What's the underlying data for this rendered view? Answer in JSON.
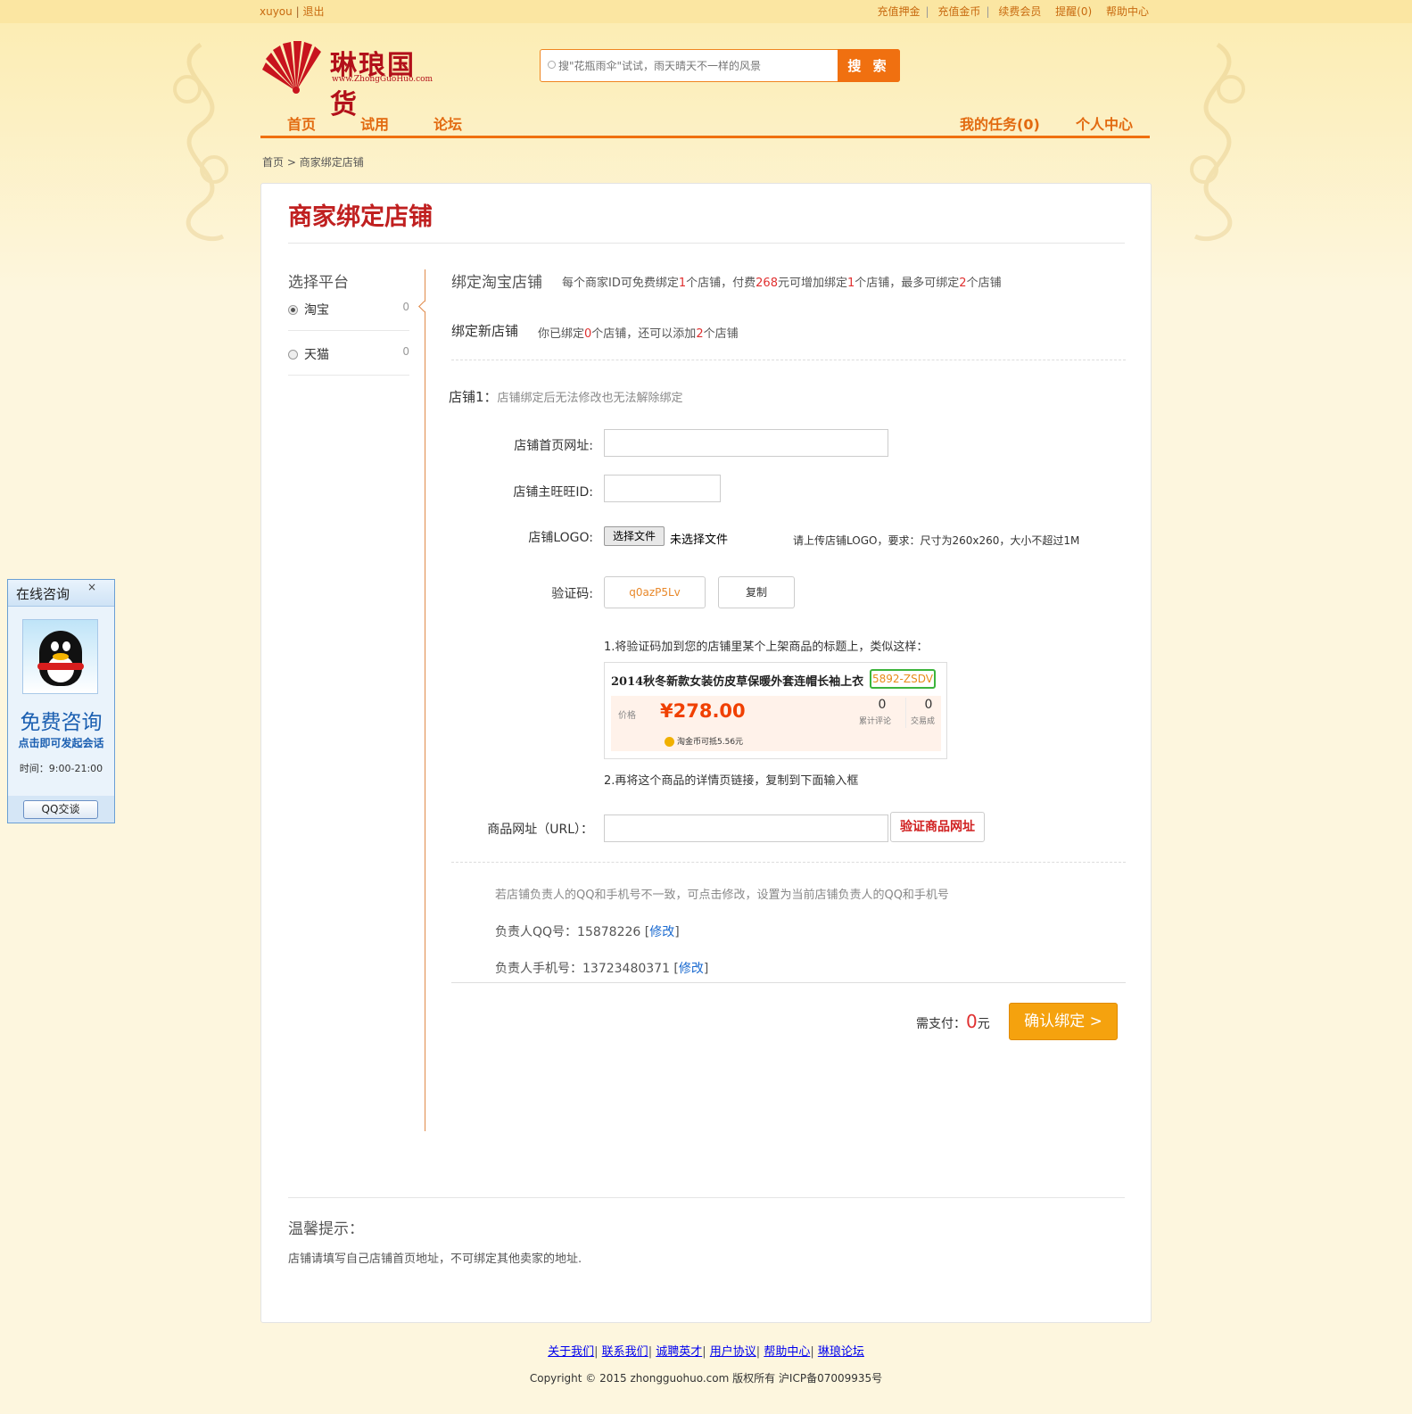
{
  "topbar": {
    "username": "xuyou",
    "logout": "退出",
    "links": [
      "充值押金",
      "充值金币",
      "续费会员",
      "提醒(0)",
      "帮助中心"
    ]
  },
  "logo": {
    "name": "琳琅国货",
    "url": "www.ZhongGuoHuo.com"
  },
  "search": {
    "placeholder": "搜\"花瓶雨伞\"试试，雨天晴天不一样的风景",
    "button": "搜 索"
  },
  "nav": {
    "left": [
      "首页",
      "试用",
      "论坛"
    ],
    "right": [
      "我的任务(0)",
      "个人中心"
    ]
  },
  "breadcrumb": {
    "home": "首页",
    "sep": ">",
    "current": "商家绑定店铺"
  },
  "page_title": "商家绑定店铺",
  "platform": {
    "title": "选择平台",
    "items": [
      {
        "label": "淘宝",
        "count": "0",
        "selected": true
      },
      {
        "label": "天猫",
        "count": "0",
        "selected": false
      }
    ]
  },
  "bind_info": {
    "heading": "绑定淘宝店铺",
    "desc_1": "每个商家ID可免费绑定",
    "free_count": "1",
    "desc_2": "个店铺，付费",
    "fee": "268",
    "desc_3": "元可增加绑定",
    "extra_count": "1",
    "desc_4": "个店铺，最多可绑定",
    "max_count": "2",
    "desc_5": "个店铺"
  },
  "new_shop": {
    "heading": "绑定新店铺",
    "desc_1": "你已绑定",
    "bound": "0",
    "desc_2": "个店铺，还可以添加",
    "remain": "2",
    "desc_3": "个店铺"
  },
  "shop1": {
    "title": "店铺1：",
    "note": "店铺绑定后无法修改也无法解除绑定",
    "url_label": "店铺首页网址:",
    "wangwang_label": "店铺主旺旺ID:",
    "logo_label": "店铺LOGO:",
    "file_button": "选择文件",
    "file_status": "未选择文件",
    "logo_hint": "请上传店铺LOGO，要求：尺寸为260x260，大小不超过1M",
    "code_label": "验证码:",
    "code_value": "q0azP5Lv",
    "copy_button": "复制",
    "step1": "1.将验证码加到您的店铺里某个上架商品的标题上，类似这样：",
    "step2": "2.再将这个商品的详情页链接，复制到下面输入框",
    "product_url_label": "商品网址（URL）：",
    "verify_button": "验证商品网址"
  },
  "sample_product": {
    "title": "2014秋冬新款女装仿皮草保暖外套连帽长袖上衣",
    "code": "5892-ZSDV",
    "price_label": "价格",
    "price": "¥278.00",
    "reviews_count": "0",
    "reviews_label": "累计评论",
    "deals_count": "0",
    "deals_label": "交易成",
    "coin_note": "淘金币可抵5.56元"
  },
  "contact": {
    "note": "若店铺负责人的QQ和手机号不一致，可点击修改，设置为当前店铺负责人的QQ和手机号",
    "qq_label": "负责人QQ号：",
    "qq": "15878226",
    "phone_label": "负责人手机号：",
    "phone": "13723480371",
    "edit": "修改"
  },
  "payment": {
    "label": "需支付：",
    "amount": "0",
    "unit": "元",
    "confirm": "确认绑定 >"
  },
  "tips": {
    "title": "温馨提示：",
    "text": "店铺请填写自己店铺首页地址，不可绑定其他卖家的地址."
  },
  "footer": {
    "links": [
      "关于我们",
      "联系我们",
      "诚聘英才",
      "用户协议",
      "帮助中心",
      "琳琅论坛"
    ],
    "copyright": "Copyright © 2015 zhongguohuo.com 版权所有 沪ICP备07009935号"
  },
  "qq_widget": {
    "title": "在线咨询",
    "close": "×",
    "headline": "免费咨询",
    "sub": "点击即可发起会话",
    "hours": "时间：9:00-21:00",
    "button": "QQ交谈"
  },
  "colors": {
    "accent": "#f07010",
    "title_red": "#c02020",
    "highlight_red": "#e03030",
    "confirm": "#f5a20e"
  }
}
